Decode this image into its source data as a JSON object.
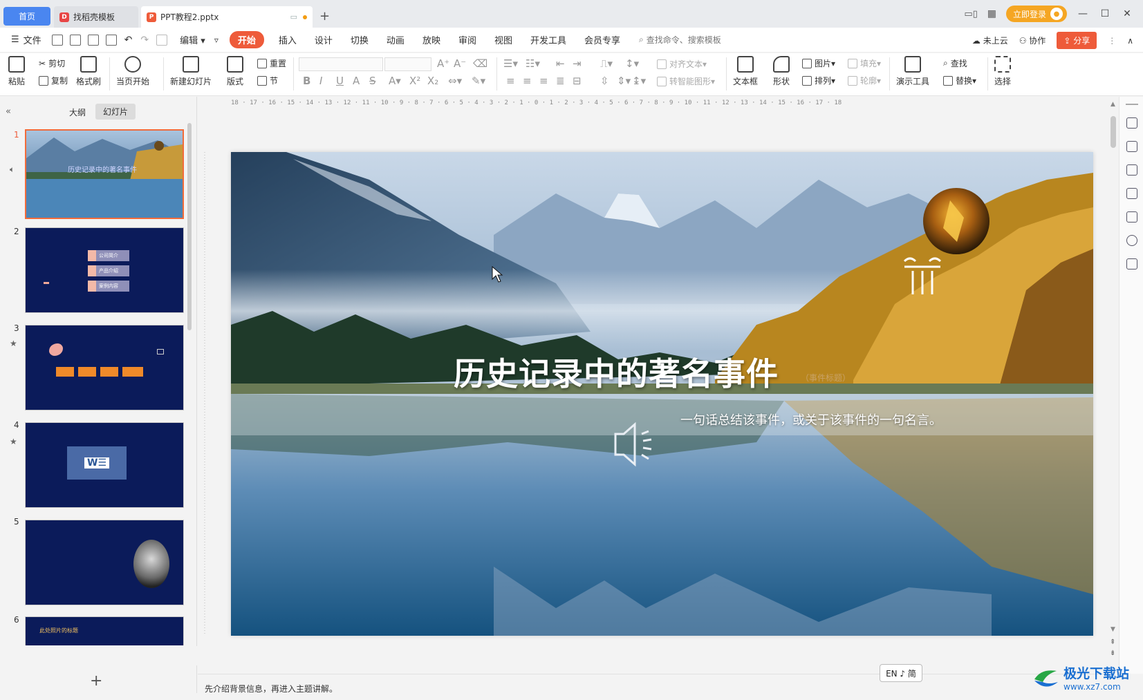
{
  "tabs": {
    "home": "首页",
    "template": "找稻壳模板",
    "document": "PPT教程2.pptx"
  },
  "titlebar": {
    "login": "立即登录"
  },
  "menu": {
    "file": "文件",
    "edit": "编辑",
    "items": [
      "开始",
      "插入",
      "设计",
      "切换",
      "动画",
      "放映",
      "审阅",
      "视图",
      "开发工具",
      "会员专享"
    ],
    "search_placeholder": "查找命令、搜索模板",
    "cloud": "未上云",
    "collab": "协作",
    "share": "分享"
  },
  "ribbon": {
    "paste": "粘贴",
    "cut": "剪切",
    "copy": "复制",
    "format_painter": "格式刷",
    "from_current": "当页开始",
    "new_slide": "新建幻灯片",
    "layout": "版式",
    "reset": "重置",
    "section": "节",
    "align_text": "对齐文本",
    "smart_art": "转智能图形",
    "textbox": "文本框",
    "shape": "形状",
    "picture": "图片",
    "arrange": "排列",
    "fill": "填充",
    "outline": "轮廓",
    "present_tools": "演示工具",
    "find": "查找",
    "replace": "替换",
    "select": "选择"
  },
  "panel": {
    "outline_tab": "大纲",
    "slides_tab": "幻灯片",
    "slide_numbers": [
      "1",
      "2",
      "3",
      "4",
      "5",
      "6"
    ],
    "slide2_items": [
      "公司简介",
      "产品介绍",
      "案例内容"
    ],
    "slide6_title": "此处照片的标题"
  },
  "slide": {
    "title": "历史记录中的著名事件",
    "tag": "（事件标题）",
    "subtitle": "一句话总结该事件，或关于该事件的一句名言。"
  },
  "ruler": {
    "h_labels": "18 · 17 · 16 · 15 · 14 · 13 · 12 · 11 · 10 · 9 · 8 · 7 · 6 · 5 · 4 · 3 · 2 · 1 · 0 · 1 · 2 · 3 · 4 · 5 · 6 · 7 · 8 · 9 · 10 · 11 · 12 · 13 · 14 · 15 · 16 · 17 · 18"
  },
  "notes": {
    "text": "先介绍背景信息，再进入主题讲解。"
  },
  "ime": {
    "label": "EN ♪ 简"
  },
  "watermark": {
    "title": "极光下载站",
    "url": "www.xz7.com"
  },
  "colors": {
    "accent": "#ee5b3a",
    "tab_home": "#4a86f0",
    "thumb_bg": "#0b1b5a",
    "selected_border": "#f26b3a"
  }
}
